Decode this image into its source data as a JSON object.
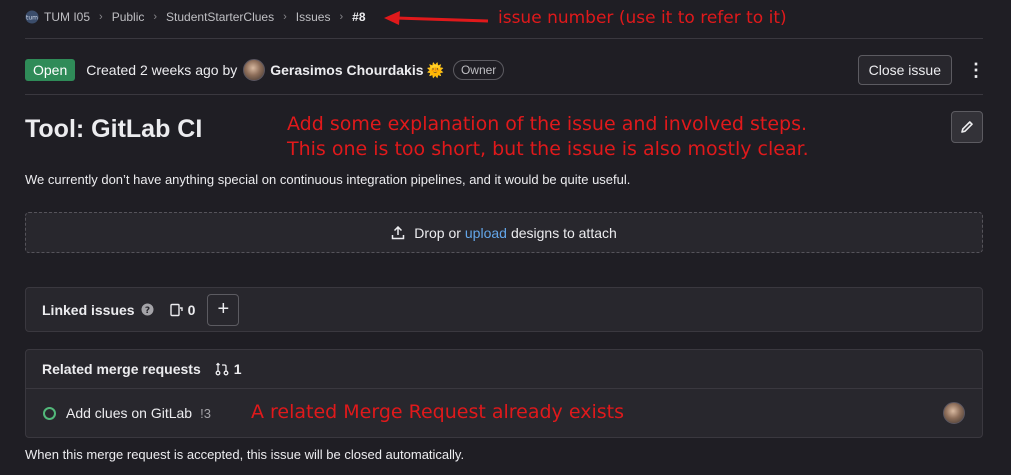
{
  "breadcrumb": {
    "items": [
      "TUM I05",
      "Public",
      "StudentStarterClues",
      "Issues"
    ],
    "current": "#8",
    "separator": "›"
  },
  "annotations": {
    "issue_number": "issue number (use it to refer to it)",
    "description_line1": "Add some explanation of the issue and involved steps.",
    "description_line2": "This one is too short, but the issue is also mostly clear.",
    "merge_request": "A related Merge Request already exists"
  },
  "header": {
    "status": "Open",
    "created": "Created 2 weeks ago by",
    "author": "Gerasimos Chourdakis",
    "author_emoji": "🌞",
    "role": "Owner",
    "close_button": "Close issue",
    "more_icon": "kebab-menu-icon"
  },
  "issue": {
    "title": "Tool: GitLab CI",
    "description": "We currently don’t have anything special on continuous integration pipelines, and it would be quite useful."
  },
  "designs": {
    "prefix": "Drop or",
    "link": "upload",
    "suffix": "designs to attach"
  },
  "linked_issues": {
    "label": "Linked issues",
    "count": "0",
    "add": "+"
  },
  "related_mrs": {
    "label": "Related merge requests",
    "count": "1",
    "items": [
      {
        "title": "Add clues on GitLab",
        "ref": "!3"
      }
    ]
  },
  "footer": "When this merge request is accepted, this issue will be closed automatically.",
  "colors": {
    "background": "#1f1e24",
    "open_badge": "#2f8b58",
    "link": "#63a6e9",
    "annotation": "#e0191b"
  }
}
